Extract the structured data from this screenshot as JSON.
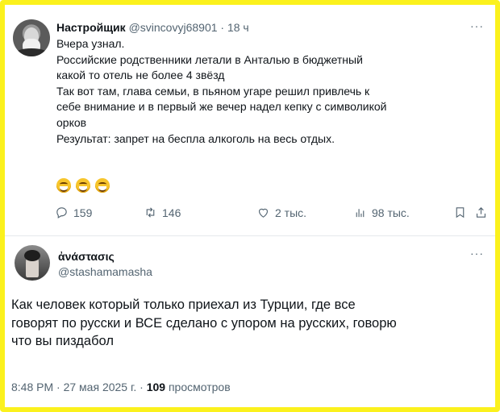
{
  "tweet1": {
    "author_name": "Настройщик",
    "handle": "@svincovyj68901",
    "separator": " · ",
    "time": "18 ч",
    "more": "···",
    "lines": [
      "Вчера узнал.",
      "Российские родственники летали в Анталью в бюджетный",
      "какой то отель не более 4 звёзд",
      "Так вот там, глава семьи, в пьяном угаре решил привлечь к",
      "себе внимание и в первый же вечер надел кепку с  символикой",
      "орков",
      "Результат: запрет на беспла алкоголь на весь отдых."
    ],
    "emojis": [
      "grinning-face",
      "grinning-face",
      "grinning-face"
    ],
    "stats": {
      "replies": "159",
      "reposts": "146",
      "likes": "2 тыс.",
      "views": "98 тыс."
    }
  },
  "tweet2": {
    "author_name": "ἀνάστασις",
    "handle": "@stashamamasha",
    "more": "···",
    "lines": [
      "Как человек который только приехал из Турции, где все",
      "говорят по русски и ВСЕ сделано с упором на русских, говорю",
      "что вы пиздабол"
    ],
    "footer": {
      "time": "8:48 PM",
      "separator": " · ",
      "date": "27 мая 2025 г.",
      "separator2": " · ",
      "views": "109",
      "views_label": " просмотров"
    }
  },
  "colors": {
    "frame": "#fbf11d",
    "text": "#0f1419",
    "muted": "#536471"
  }
}
